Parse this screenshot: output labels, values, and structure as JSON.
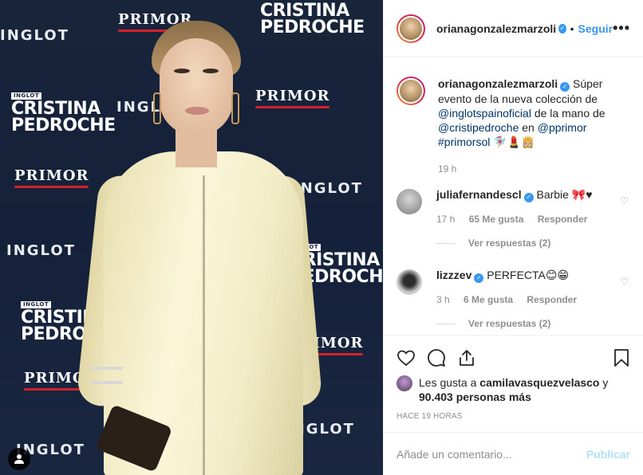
{
  "photo": {
    "backdrop_logos": {
      "primor": "PRIMOR",
      "inglot": "INGLOT",
      "cristina_line1": "CRISTINA",
      "cristina_line2": "PEDROCHE",
      "badge": "INGLOT"
    }
  },
  "header": {
    "username": "orianagonzalezmarzoli",
    "follow_label": "Seguir",
    "more_label": "•••"
  },
  "caption": {
    "username": "orianagonzalezmarzoli",
    "text_1": "Súper evento de la nueva colección de",
    "mention_1": "@inglotspainoficial",
    "text_2": "de la mano de",
    "mention_2": "@cristipedroche",
    "text_3": "en",
    "mention_3": "@pprimor",
    "hashtag": "#primorsol",
    "emojis": "🧚🏼‍♀️💄👸🏼",
    "time": "19 h"
  },
  "comments": [
    {
      "username": "juliafernandescl",
      "text": "Barbie 🎀♥",
      "time": "17 h",
      "likes": "65 Me gusta",
      "reply_label": "Responder",
      "view_replies": "Ver respuestas (2)",
      "avatar_color": "#7a7a7a"
    },
    {
      "username": "lizzzev",
      "text": "PERFECTA😊😁",
      "time": "3 h",
      "likes": "6 Me gusta",
      "reply_label": "Responder",
      "view_replies": "Ver respuestas (2)",
      "avatar_color": "#2d2d2d"
    }
  ],
  "likes": {
    "line_1": "Les gusta a",
    "user": "camilavasquezvelasco",
    "line_2": "y",
    "count": "90.403 personas más"
  },
  "date": "HACE 19 HORAS",
  "comment_box": {
    "placeholder": "Añade un comentario...",
    "publish_label": "Publicar"
  },
  "colors": {
    "accent": "#3897f0",
    "link": "#003569",
    "muted": "#8e8e8e",
    "publish_disabled": "#b2dffc"
  }
}
